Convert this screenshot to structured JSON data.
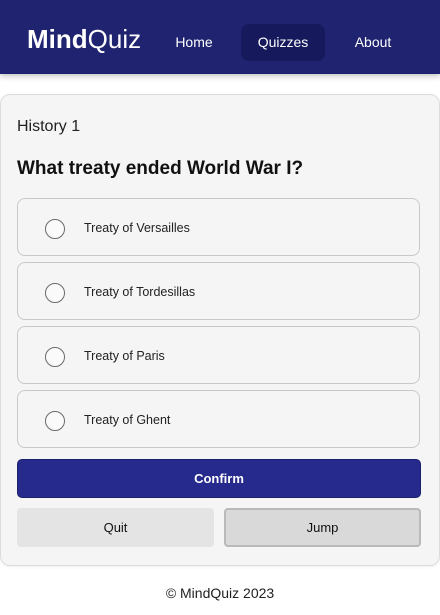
{
  "header": {
    "logo_bold": "Mind",
    "logo_light": "Quiz",
    "nav": [
      {
        "label": "Home"
      },
      {
        "label": "Quizzes"
      },
      {
        "label": "About"
      }
    ],
    "active_nav": "Quizzes"
  },
  "quiz": {
    "label": "History 1",
    "question": "What treaty ended World War I?",
    "options": [
      {
        "label": "Treaty of Versailles",
        "selected": false
      },
      {
        "label": "Treaty of Tordesillas",
        "selected": false
      },
      {
        "label": "Treaty of Paris",
        "selected": false
      },
      {
        "label": "Treaty of Ghent",
        "selected": false
      }
    ]
  },
  "actions": {
    "confirm_label": "Confirm",
    "quit_label": "Quit",
    "jump_label": "Jump"
  },
  "footer": {
    "text": "© MindQuiz 2023"
  },
  "colors": {
    "header_bg": "#1f2370",
    "active_nav_bg": "#161a5c",
    "confirm_bg": "#262a8c",
    "card_bg": "#f5f5f5"
  }
}
